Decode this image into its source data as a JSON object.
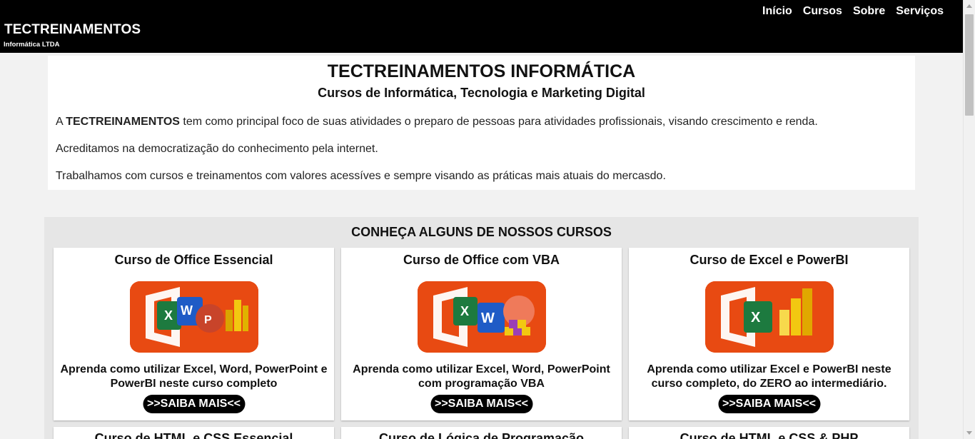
{
  "header": {
    "brand": "TECTREINAMENTOS",
    "brand_sub": "Informática LTDA",
    "nav": [
      "Início",
      "Cursos",
      "Sobre",
      "Serviços"
    ]
  },
  "intro": {
    "title": "TECTREINAMENTOS INFORMÁTICA",
    "subtitle": "Cursos de Informática, Tecnologia e Marketing Digital",
    "p1_prefix": "A ",
    "p1_bold": "TECTREINAMENTOS",
    "p1_rest": " tem como principal foco de suas atividades o preparo de pessoas para atividades profissionais, visando crescimento e renda.",
    "p2": "Acreditamos na democratização do conhecimento pela internet.",
    "p3": "Trabalhamos com cursos e treinamentos com valores acessíves e sempre visando as práticas mais atuais do mercasdo."
  },
  "courses": {
    "title": "CONHEÇA ALGUNS DE NOSSOS CURSOS",
    "cards": [
      {
        "title": "Curso de Office Essencial",
        "desc": "Aprenda como utilizar Excel, Word, PowerPoint e PowerBI neste curso completo",
        "button": ">>SAIBA MAIS<<",
        "icon": "office-essencial-icon"
      },
      {
        "title": "Curso de Office com VBA",
        "desc": "Aprenda como utilizar Excel, Word, PowerPoint com programação VBA",
        "button": ">>SAIBA MAIS<<",
        "icon": "office-vba-icon"
      },
      {
        "title": "Curso de Excel e PowerBI",
        "desc": "Aprenda como utilizar Excel e PowerBI neste curso completo, do ZERO ao intermediário.",
        "button": ">>SAIBA MAIS<<",
        "icon": "excel-powerbi-icon"
      }
    ],
    "next_row": [
      "Curso de HTML e CSS Essencial",
      "Curso de Lógica de Programação",
      "Curso de HTML e CSS & PHP"
    ]
  },
  "colors": {
    "header_bg": "#000000",
    "office_orange": "#e84a12",
    "excel_green": "#1d7a3f",
    "word_blue": "#1f5bc6",
    "ppt_red": "#c8442a",
    "powerbi_yellow": "#f2c811"
  }
}
